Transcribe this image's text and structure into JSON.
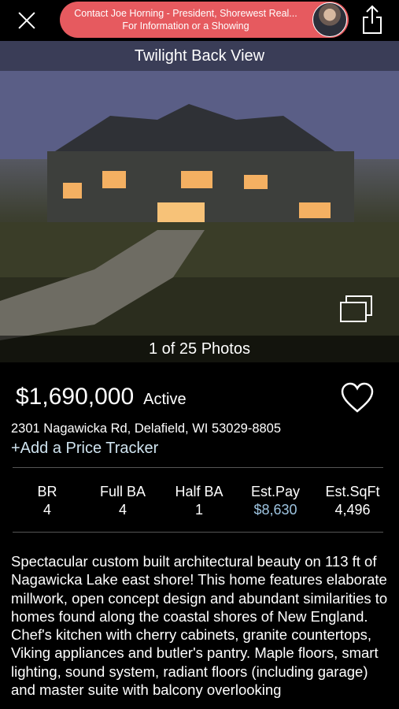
{
  "header": {
    "contact_text": "Contact Joe Horning - President, Shorewest Real...\nFor Information or a Showing"
  },
  "photo": {
    "title": "Twilight Back View",
    "counter": "1 of 25 Photos"
  },
  "listing": {
    "price": "$1,690,000",
    "status": "Active",
    "address": "2301 Nagawicka Rd, Delafield, WI 53029-8805",
    "add_tracker": "+Add a Price Tracker"
  },
  "stats": [
    {
      "label": "BR",
      "value": "4"
    },
    {
      "label": "Full BA",
      "value": "4"
    },
    {
      "label": "Half BA",
      "value": "1"
    },
    {
      "label": "Est.Pay",
      "value": "$8,630"
    },
    {
      "label": "Est.SqFt",
      "value": "4,496"
    }
  ],
  "description": "Spectacular custom built architectural beauty on 113 ft of Nagawicka Lake east shore! This home features elaborate millwork, open concept design and abundant similarities to homes found along the coastal shores of New England. Chef's kitchen with cherry cabinets, granite countertops, Viking appliances and butler's pantry. Maple floors, smart lighting, sound system, radiant floors (including garage) and master suite with balcony overlooking",
  "colors": {
    "contact_pill": "#e65a5f",
    "link": "#9ec4e0",
    "background": "#000000"
  }
}
